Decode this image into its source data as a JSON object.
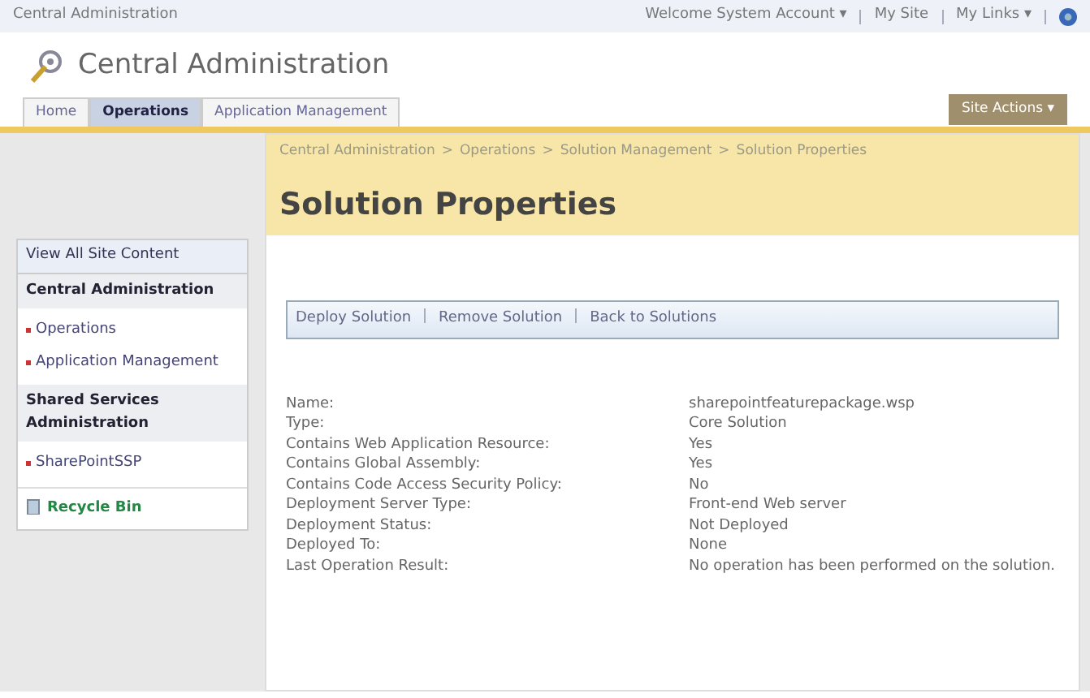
{
  "top_bar": {
    "site": "Central Administration",
    "welcome": "Welcome System Account ▾",
    "my_site": "My Site",
    "my_links": "My Links ▾"
  },
  "title": "Central Administration",
  "tabs": [
    {
      "label": "Home",
      "selected": false
    },
    {
      "label": "Operations",
      "selected": true
    },
    {
      "label": "Application Management",
      "selected": false
    }
  ],
  "site_actions": "Site Actions ▾",
  "breadcrumb_separator": ">",
  "breadcrumb": [
    "Central Administration",
    "Operations",
    "Solution Management",
    "Solution Properties"
  ],
  "page_title": "Solution Properties",
  "sidebar": {
    "view_all": "View All Site Content",
    "sections": [
      {
        "heading": "Central Administration",
        "items": [
          "Operations",
          "Application Management"
        ]
      },
      {
        "heading": "Shared Services Administration",
        "items": [
          "SharePointSSP"
        ]
      }
    ],
    "recycle_bin": "Recycle Bin"
  },
  "toolbar": [
    "Deploy Solution",
    "Remove Solution",
    "Back to Solutions"
  ],
  "properties": [
    {
      "label": "Name:",
      "value": "sharepointfeaturepackage.wsp"
    },
    {
      "label": "Type:",
      "value": "Core Solution"
    },
    {
      "label": "Contains Web Application Resource:",
      "value": "Yes"
    },
    {
      "label": "Contains Global Assembly:",
      "value": "Yes"
    },
    {
      "label": "Contains Code Access Security Policy:",
      "value": "No"
    },
    {
      "label": "Deployment Server Type:",
      "value": "Front-end Web server"
    },
    {
      "label": "Deployment Status:",
      "value": "Not Deployed"
    },
    {
      "label": "Deployed To:",
      "value": "None"
    },
    {
      "label": "Last Operation Result:",
      "value": "No operation has been performed on the solution."
    }
  ]
}
